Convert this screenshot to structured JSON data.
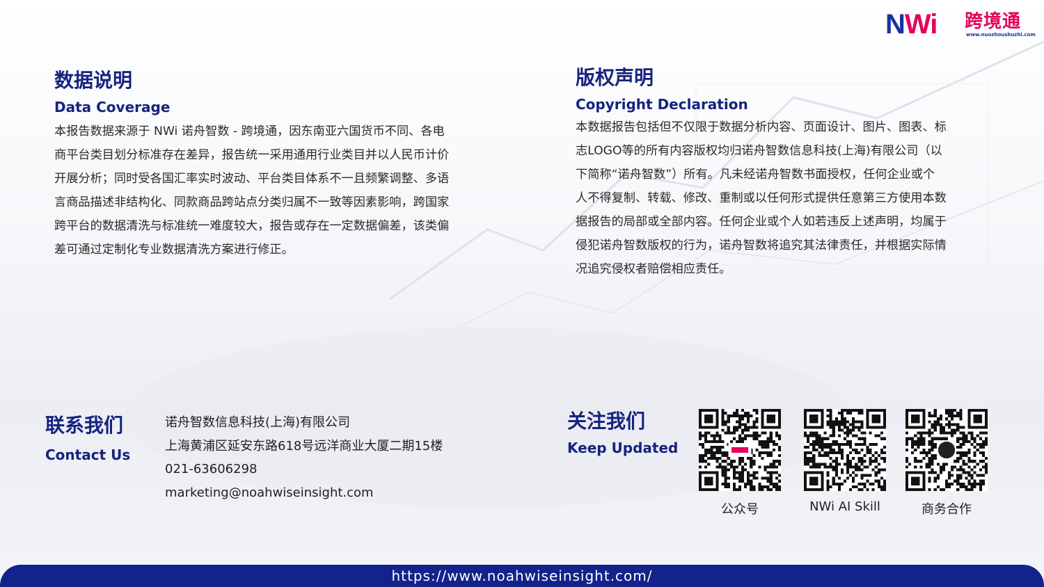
{
  "logo": {
    "mark_n": "N",
    "mark_wi": "Wi",
    "name_cn": "跨境通",
    "url": "www.nuozhoushuzhi.com"
  },
  "data_coverage": {
    "title_cn": "数据说明",
    "title_en": "Data Coverage",
    "lines": [
      "本报告数据来源于 NWi 诺舟智数 - 跨境通，因东南亚六国货币不同、各电",
      "商平台类目划分标准存在差异，报告统一采用通用行业类目并以人民币计价",
      "开展分析；同时受各国汇率实时波动、平台类目体系不一且频繁调整、多语",
      "言商品描述非结构化、同款商品跨站点分类归属不一致等因素影响，跨国家",
      "跨平台的数据清洗与标准统一难度较大，报告或存在一定数据偏差，该类偏",
      "差可通过定制化专业数据清洗方案进行修正。"
    ]
  },
  "copyright": {
    "title_cn": "版权声明",
    "title_en": "Copyright Declaration",
    "lines": [
      "本数据报告包括但不仅限于数据分析内容、页面设计、图片、图表、标",
      "志LOGO等的所有内容版权均归诺舟智数信息科技(上海)有限公司（以",
      "下简称“诺舟智数”）所有。凡未经诺舟智数书面授权，任何企业或个",
      "人不得复制、转载、修改、重制或以任何形式提供任意第三方使用本数",
      "据报告的局部或全部内容。任何企业或个人如若违反上述声明，均属于",
      "侵犯诺舟智数版权的行为，诺舟智数将追究其法律责任，并根据实际情",
      "况追究侵权者赔偿相应责任。"
    ]
  },
  "contact": {
    "title_cn": "联系我们",
    "title_en": "Contact Us",
    "company": "诺舟智数信息科技(上海)有限公司",
    "address": "上海黄浦区延安东路618号远洋商业大厦二期15楼",
    "phone": "021-63606298",
    "email": "marketing@noahwiseinsight.com"
  },
  "follow": {
    "title_cn": "关注我们",
    "title_en": "Keep Updated",
    "qrcodes": [
      {
        "label": "公众号",
        "icon": "logo-badge-icon"
      },
      {
        "label": "NWi AI Skill",
        "icon": "none"
      },
      {
        "label": "商务合作",
        "icon": "wechat-icon"
      }
    ]
  },
  "footer": {
    "url": "https://www.noahwiseinsight.com/"
  },
  "colors": {
    "brand_navy": "#16237e",
    "brand_pink": "#e5005a",
    "footer_bar": "#13238c"
  }
}
